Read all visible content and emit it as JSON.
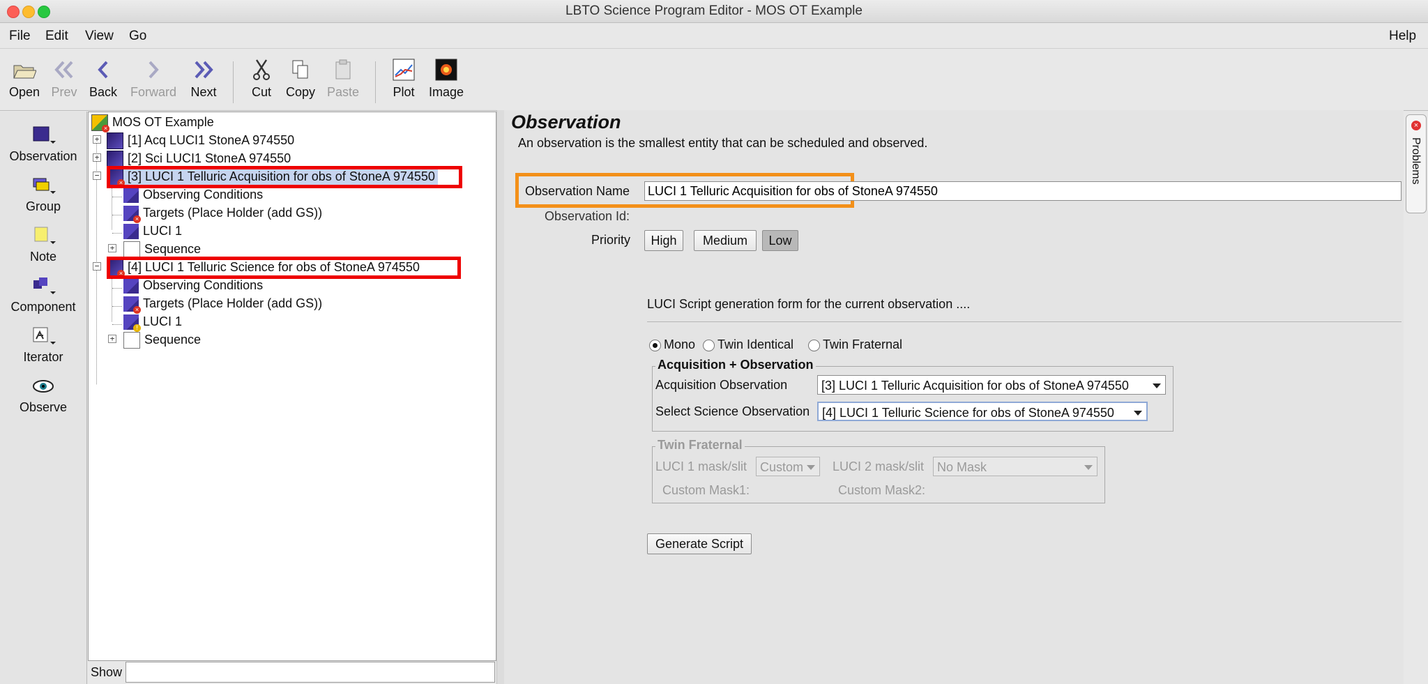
{
  "window": {
    "title": "LBTO Science Program Editor - MOS OT Example"
  },
  "menubar": {
    "file": "File",
    "edit": "Edit",
    "view": "View",
    "go": "Go",
    "help": "Help"
  },
  "toolbar": {
    "open": "Open",
    "prev": "Prev",
    "back": "Back",
    "forward": "Forward",
    "next": "Next",
    "cut": "Cut",
    "copy": "Copy",
    "paste": "Paste",
    "plot": "Plot",
    "image": "Image"
  },
  "palette": {
    "observation": "Observation",
    "group": "Group",
    "note": "Note",
    "component": "Component",
    "iterator": "Iterator",
    "observe": "Observe"
  },
  "tree": {
    "root": "MOS OT Example",
    "obs1": "[1] Acq LUCI1 StoneA 974550",
    "obs2": "[2] Sci LUCI1 StoneA 974550",
    "obs3": "[3] LUCI 1 Telluric Acquisition for obs of StoneA 974550",
    "obs3_children": [
      "Observing Conditions",
      "Targets (Place Holder (add GS))",
      "LUCI 1",
      "Sequence"
    ],
    "obs4": "[4] LUCI 1 Telluric Science for obs of StoneA 974550",
    "obs4_children": [
      "Observing Conditions",
      "Targets (Place Holder (add GS))",
      "LUCI 1",
      "Sequence"
    ]
  },
  "show": {
    "label": "Show",
    "value": ""
  },
  "editor": {
    "heading": "Observation",
    "description": "An observation is the smallest entity that can be scheduled and observed.",
    "name_label": "Observation Name",
    "name_value": "LUCI 1 Telluric Acquisition for obs of StoneA 974550",
    "id_label": "Observation Id:",
    "priority_label": "Priority",
    "priority": {
      "high": "High",
      "medium": "Medium",
      "low": "Low",
      "selected": "Low"
    },
    "script_title": "LUCI Script generation form for the current observation ....",
    "modes": {
      "mono": "Mono",
      "twin_identical": "Twin Identical",
      "twin_fraternal": "Twin Fraternal",
      "selected": "Mono"
    },
    "acq_group": {
      "title": "Acquisition + Observation",
      "acq_label": "Acquisition Observation",
      "acq_value": "[3] LUCI 1 Telluric Acquisition for obs of StoneA 974550",
      "sci_label": "Select Science Observation",
      "sci_value": "[4] LUCI 1 Telluric Science for obs of StoneA 974550"
    },
    "twin_group": {
      "title": "Twin Fraternal",
      "luci1_label": "LUCI 1 mask/slit",
      "luci1_value": "Custom",
      "luci2_label": "LUCI 2 mask/slit",
      "luci2_value": "No Mask",
      "mask1_label": "Custom Mask1:",
      "mask2_label": "Custom Mask2:"
    },
    "generate": "Generate Script"
  },
  "side_tab": {
    "problems": "Problems"
  },
  "colors": {
    "highlight_red": "#ee0000",
    "highlight_orange": "#f39019",
    "selection": "#c6d4ef"
  }
}
